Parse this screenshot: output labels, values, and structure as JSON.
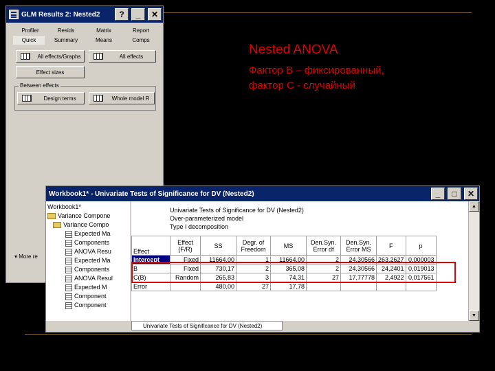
{
  "glm_window": {
    "title": "GLM Results 2: Nested2",
    "title_buttons": [
      "?",
      "_",
      "✕"
    ],
    "tabs_row1": [
      "Profiler",
      "Resids",
      "Matrix",
      "Report"
    ],
    "tabs_row2": [
      "Quick",
      "Summary",
      "Means",
      "Comps"
    ],
    "buttons": {
      "all_effects_graphs": "All effects/Graphs",
      "all_effects": "All effects",
      "effect_sizes": "Effect sizes",
      "design_terms": "Design terms",
      "whole_model_r": "Whole model R"
    },
    "between_effects": "Between effects",
    "more": "More re"
  },
  "slide": {
    "heading": "Nested ANOVA",
    "line1": "Фактор B – фиксированный,",
    "line2": "фактор C - случайный"
  },
  "workbook": {
    "title": "Workbook1* - Univariate Tests of Significance for DV (Nested2)",
    "title_buttons": [
      "_",
      "□",
      "✕"
    ],
    "tree": [
      "Workbook1*",
      "Variance Compone",
      "Variance Compo",
      "Expected Ma",
      "Components",
      "ANOVA Resu",
      "Expected Ma",
      "Components",
      "ANOVA Resul",
      "Expected M",
      "Component",
      "Component"
    ],
    "sheet_header": [
      "Univariate Tests of Significance for DV (Nested2)",
      "Over-parameterized model",
      "Type I decomposition"
    ],
    "columns": [
      "Effect",
      "Effect\n(F/R)",
      "SS",
      "Degr. of\nFreedom",
      "MS",
      "Den.Syn.\nError df",
      "Den.Syn.\nError MS",
      "F",
      "p"
    ],
    "rows": [
      [
        "Intercept",
        "Fixed",
        "11664,00",
        "1",
        "11664,00",
        "2",
        "24,30566",
        "263,2627",
        "0,000003"
      ],
      [
        "B",
        "Fixed",
        "730,17",
        "2",
        "365,08",
        "2",
        "24,30566",
        "24,2401",
        "0,019013"
      ],
      [
        "C(B)",
        "Random",
        "265,83",
        "3",
        "74,31",
        "27",
        "17,77778",
        "2,4922",
        "0,017561"
      ],
      [
        "Error",
        "",
        "480,00",
        "27",
        "17,78",
        "",
        "",
        "",
        ""
      ]
    ],
    "sheet_tab": "Univariate Tests of Significance for DV (Nested2)"
  }
}
